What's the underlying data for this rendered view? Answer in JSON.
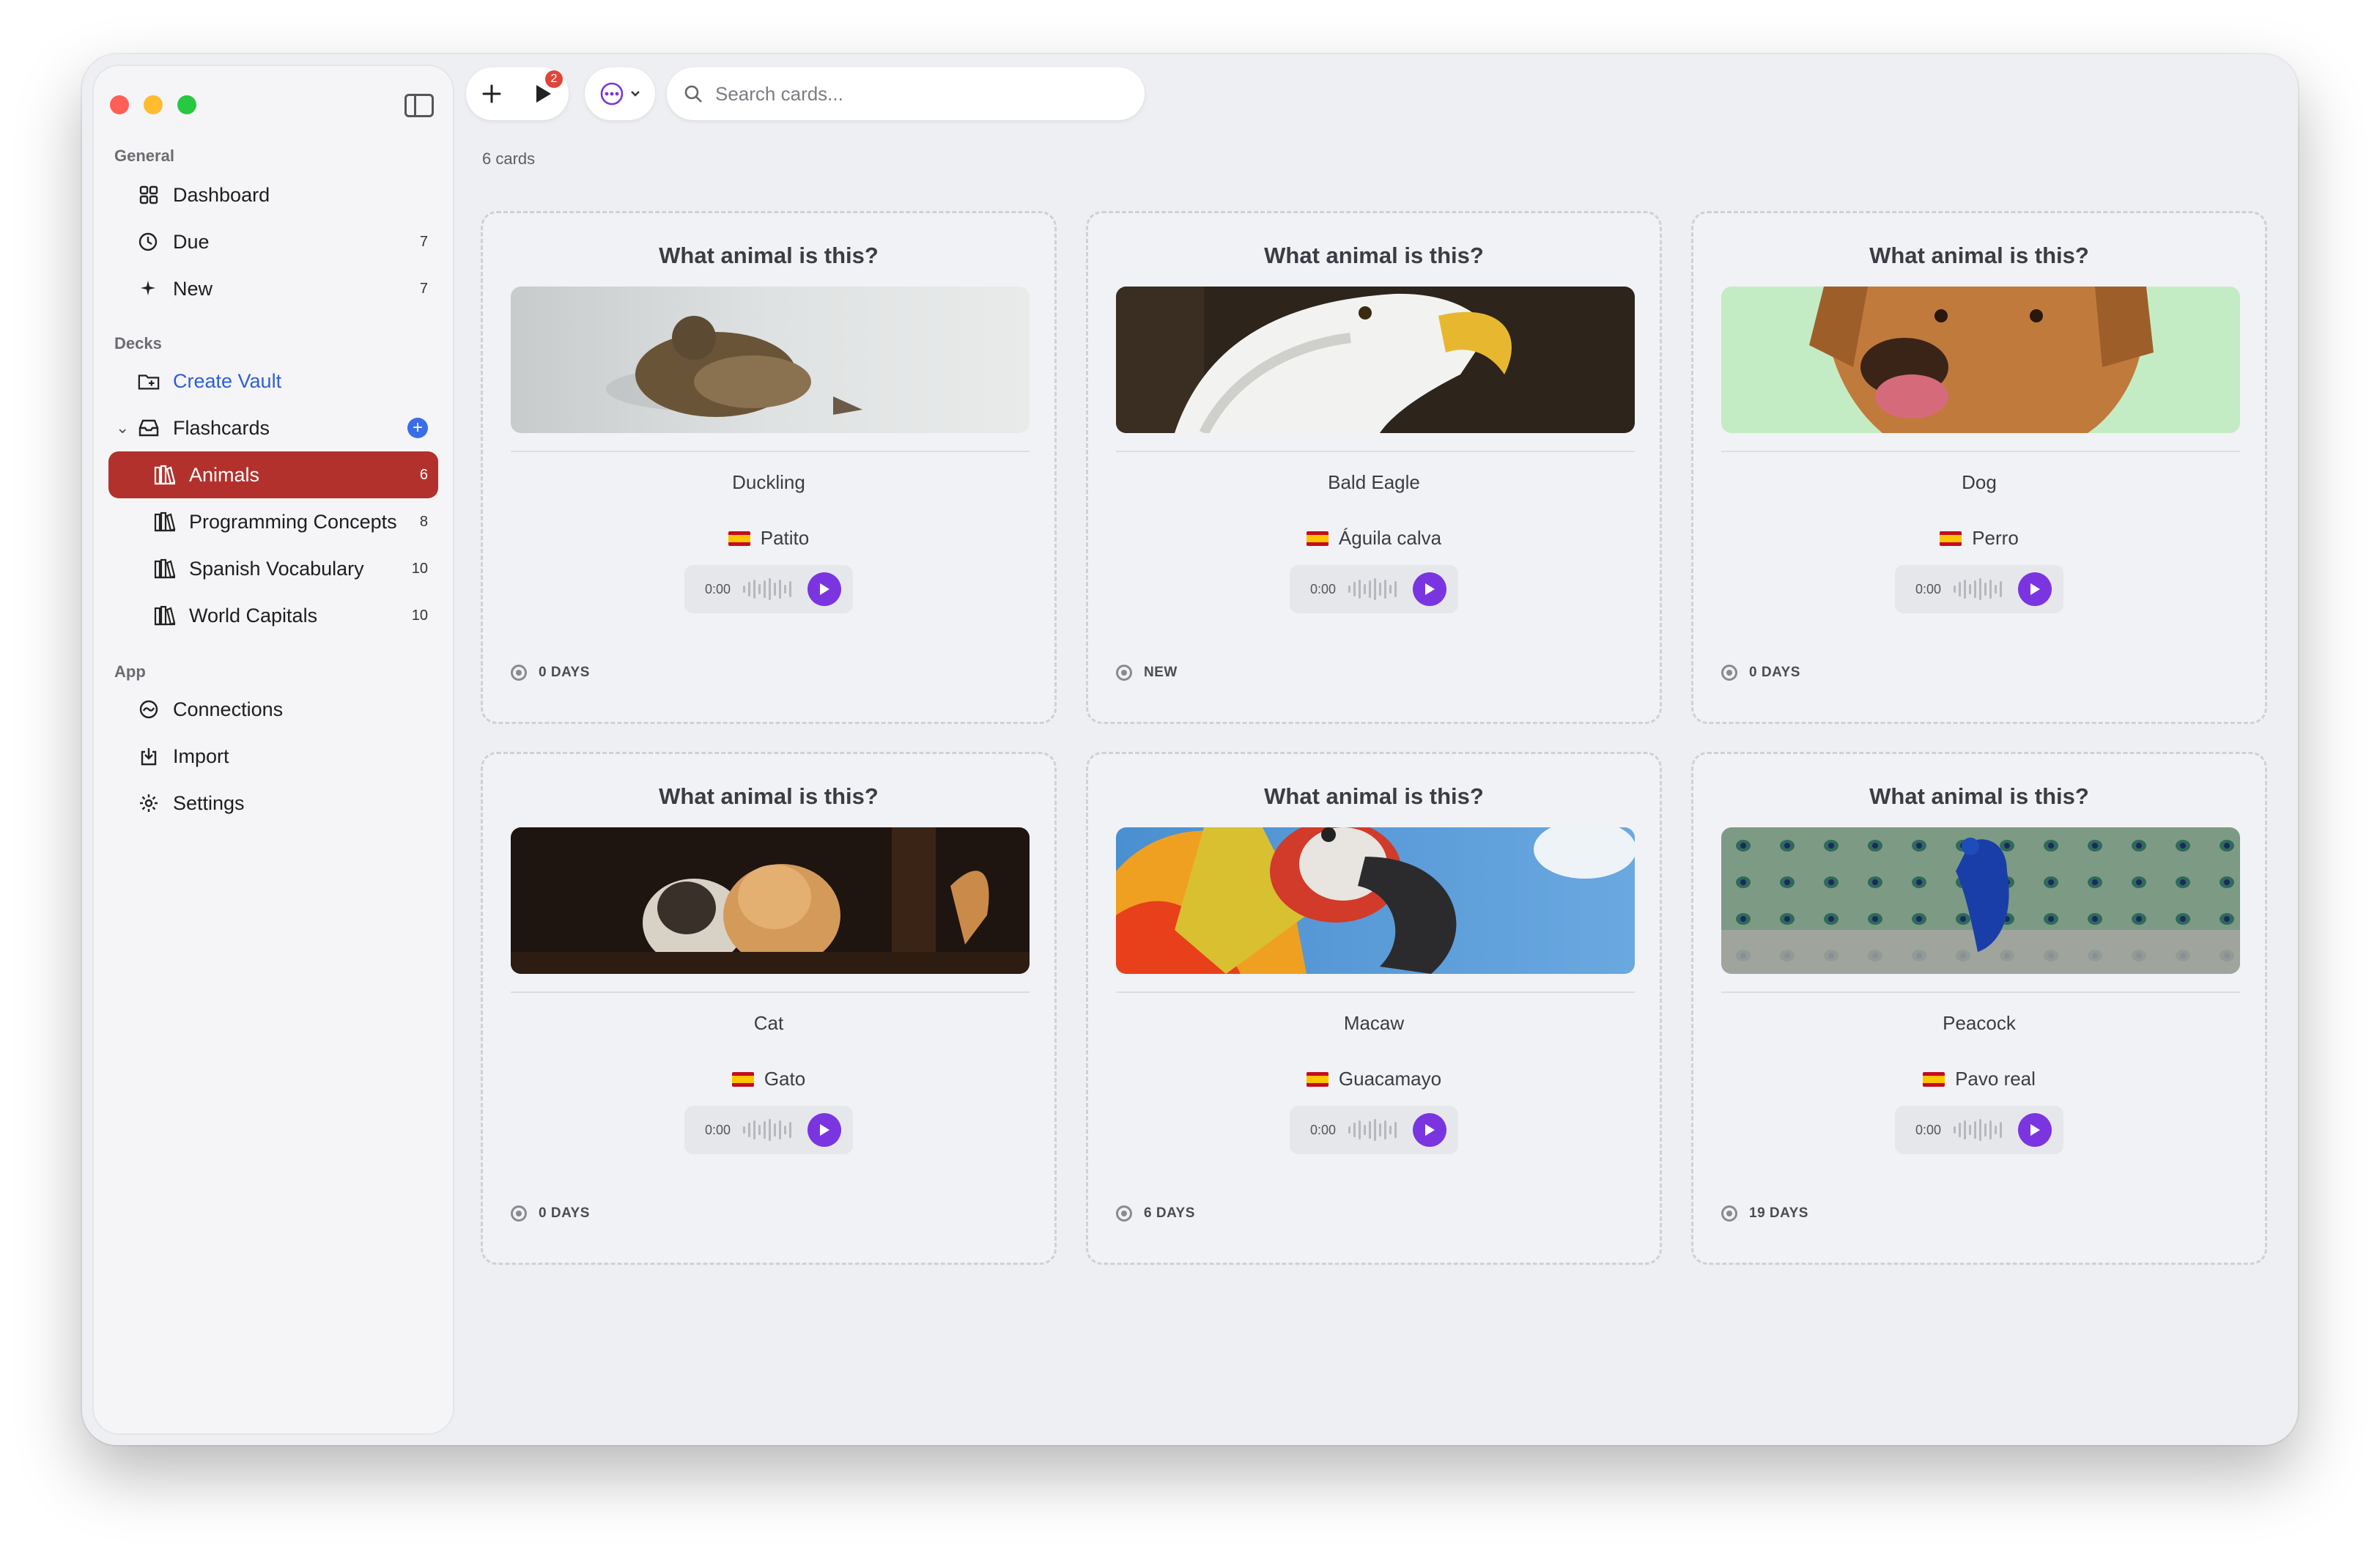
{
  "sidebar": {
    "sections": {
      "general": "General",
      "decks": "Decks",
      "app": "App"
    },
    "general_items": [
      {
        "label": "Dashboard",
        "icon": "grid-icon"
      },
      {
        "label": "Due",
        "count": "7",
        "icon": "clock-icon"
      },
      {
        "label": "New",
        "count": "7",
        "icon": "sparkle-icon"
      }
    ],
    "create_vault": "Create Vault",
    "flashcards": "Flashcards",
    "decks": [
      {
        "label": "Animals",
        "count": "6",
        "active": true
      },
      {
        "label": "Programming Concepts",
        "count": "8"
      },
      {
        "label": "Spanish Vocabulary",
        "count": "10"
      },
      {
        "label": "World Capitals",
        "count": "10"
      }
    ],
    "app_items": [
      {
        "label": "Connections",
        "icon": "connections-icon"
      },
      {
        "label": "Import",
        "icon": "import-icon"
      },
      {
        "label": "Settings",
        "icon": "gear-icon"
      }
    ]
  },
  "toolbar": {
    "play_badge": "2",
    "search_placeholder": "Search cards..."
  },
  "main": {
    "card_count": "6 cards",
    "cards": [
      {
        "question": "What animal is this?",
        "answer": "Duckling",
        "translation": "Patito",
        "audio_time": "0:00",
        "status": "0 DAYS",
        "image": "duckling-photo"
      },
      {
        "question": "What animal is this?",
        "answer": "Bald Eagle",
        "translation": "Águila calva",
        "audio_time": "0:00",
        "status": "NEW",
        "image": "eagle-photo"
      },
      {
        "question": "What animal is this?",
        "answer": "Dog",
        "translation": "Perro",
        "audio_time": "0:00",
        "status": "0 DAYS",
        "image": "dog-photo"
      },
      {
        "question": "What animal is this?",
        "answer": "Cat",
        "translation": "Gato",
        "audio_time": "0:00",
        "status": "0 DAYS",
        "image": "kittens-photo"
      },
      {
        "question": "What animal is this?",
        "answer": "Macaw",
        "translation": "Guacamayo",
        "audio_time": "0:00",
        "status": "6 DAYS",
        "image": "macaw-photo"
      },
      {
        "question": "What animal is this?",
        "answer": "Peacock",
        "translation": "Pavo real",
        "audio_time": "0:00",
        "status": "19 DAYS",
        "image": "peacock-photo"
      }
    ]
  },
  "colors": {
    "accent_active": "#b3312c",
    "play_button": "#7b35e0",
    "link": "#2d5fd8"
  }
}
